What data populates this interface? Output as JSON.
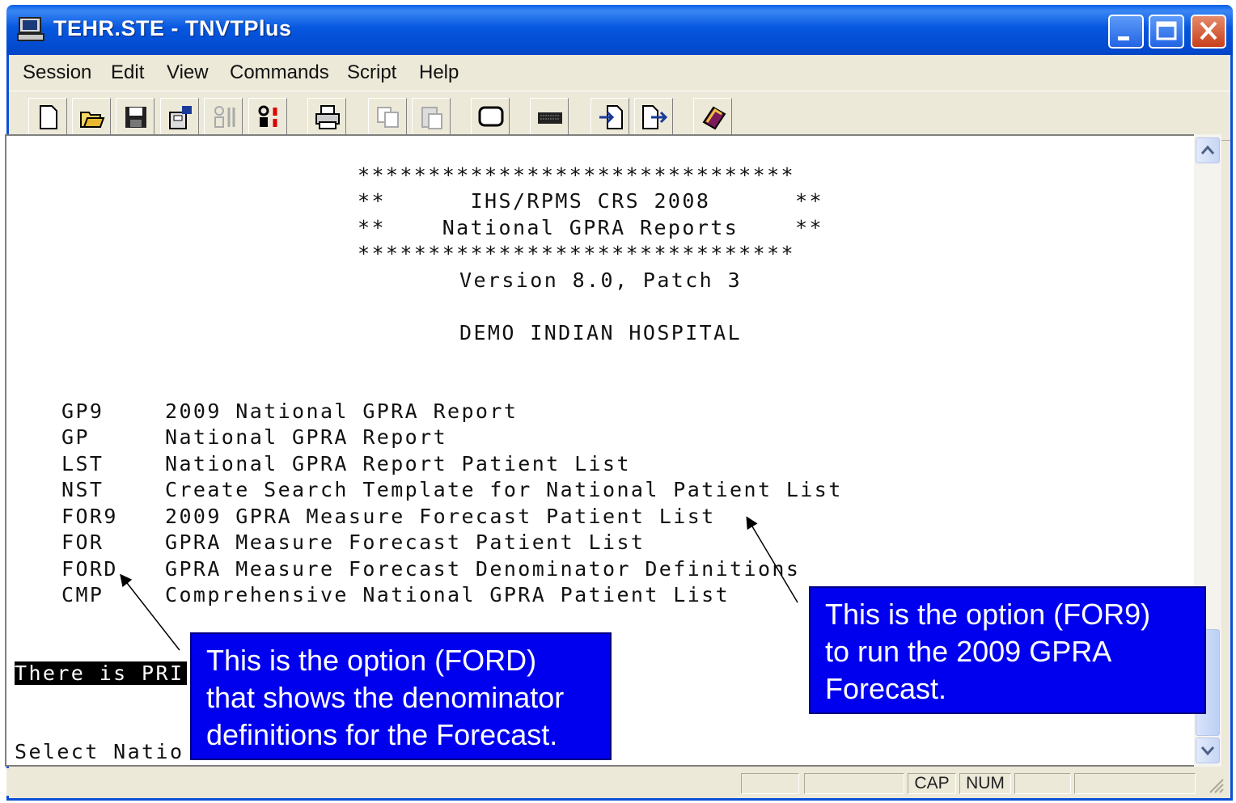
{
  "window": {
    "title": "TEHR.STE - TNVTPlus",
    "icon": "terminal-computer-icon"
  },
  "menu": {
    "items": [
      "Session",
      "Edit",
      "View",
      "Commands",
      "Script",
      "Help"
    ]
  },
  "toolbar": {
    "icons": [
      "new-document-icon",
      "open-folder-icon",
      "save-icon",
      "properties-icon",
      "disabled-settings-icon",
      "script-settings-icon",
      "print-icon",
      "copy-icon",
      "paste-icon",
      "window-icon",
      "keyboard-icon",
      "receive-file-icon",
      "send-file-icon",
      "help-book-icon"
    ]
  },
  "terminal": {
    "banner_border": "*******************************",
    "banner_line1": "**      IHS/RPMS CRS 2008      **",
    "banner_line2": "**    National GPRA Reports    **",
    "version": "Version 8.0, Patch 3",
    "facility": "DEMO INDIAN HOSPITAL",
    "options": [
      {
        "code": "GP9",
        "label": "2009 National GPRA Report"
      },
      {
        "code": "GP",
        "label": "National GPRA Report"
      },
      {
        "code": "LST",
        "label": "National GPRA Report Patient List"
      },
      {
        "code": "NST",
        "label": "Create Search Template for National Patient List"
      },
      {
        "code": "FOR9",
        "label": "2009 GPRA Measure Forecast Patient List"
      },
      {
        "code": "FOR",
        "label": "GPRA Measure Forecast Patient List"
      },
      {
        "code": "FORD",
        "label": "GPRA Measure Forecast Denominator Definitions"
      },
      {
        "code": "CMP",
        "label": "Comprehensive National GPRA Patient List"
      }
    ],
    "notice": "There is PRI",
    "prompt": "Select Natio"
  },
  "callouts": {
    "ford": [
      "This is the option (FORD)",
      "that shows the denominator",
      "definitions for the Forecast."
    ],
    "for9": [
      "This is the option (FOR9)",
      "to run the 2009 GPRA",
      "Forecast."
    ]
  },
  "statusbar": {
    "cap": "CAP",
    "num": "NUM"
  },
  "colors": {
    "title_blue": "#0758e0",
    "callout_blue": "#0000ee",
    "chrome": "#ece9d8"
  }
}
